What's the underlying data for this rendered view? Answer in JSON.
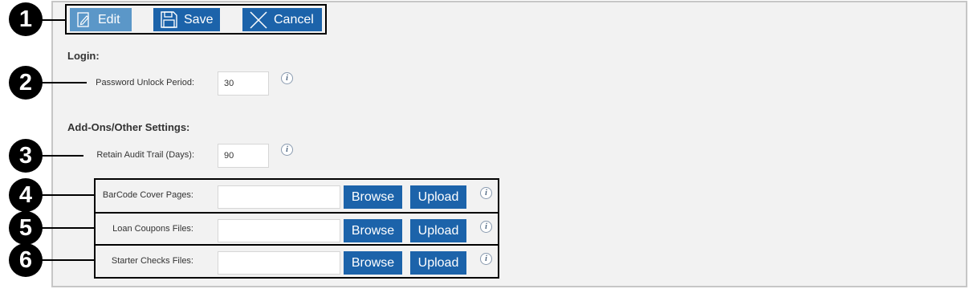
{
  "toolbar": {
    "edit_label": "Edit",
    "save_label": "Save",
    "cancel_label": "Cancel"
  },
  "login": {
    "title": "Login:",
    "password_unlock_label": "Password Unlock Period:",
    "password_unlock_value": "30"
  },
  "addons": {
    "title": "Add-Ons/Other Settings:",
    "audit_trail_label": "Retain Audit Trail (Days):",
    "audit_trail_value": "90"
  },
  "uploads": [
    {
      "label": "BarCode Cover Pages:",
      "value": "",
      "browse_label": "Browse",
      "upload_label": "Upload"
    },
    {
      "label": "Loan Coupons Files:",
      "value": "",
      "browse_label": "Browse",
      "upload_label": "Upload"
    },
    {
      "label": "Starter Checks Files:",
      "value": "",
      "browse_label": "Browse",
      "upload_label": "Upload"
    }
  ],
  "info_glyph": "i",
  "markers": [
    "1",
    "2",
    "3",
    "4",
    "5",
    "6"
  ],
  "colors": {
    "button_primary": "#1c63aa",
    "button_disabled": "#5b97c8",
    "panel_bg": "#f2f2f2"
  }
}
